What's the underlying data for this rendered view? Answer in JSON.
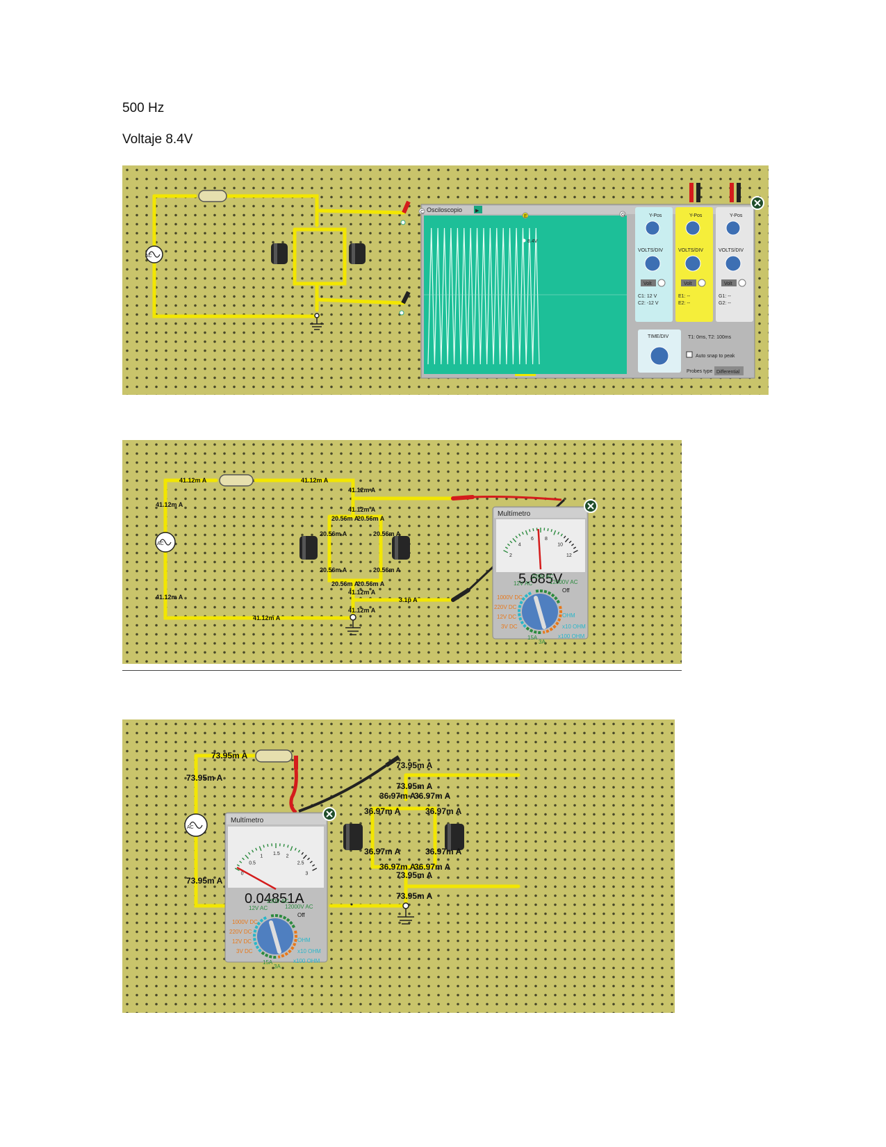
{
  "headings": {
    "frequency": "500 Hz",
    "voltage": "Voltaje 8.4V"
  },
  "colors": {
    "board": "#c9c46b",
    "wire": "#f2e600",
    "scope_screen": "#1dbf98",
    "trace": "#e8fff6",
    "probe_red": "#d41c1c",
    "probe_black": "#222222"
  },
  "panel1": {
    "source_label": "AC",
    "oscilloscope": {
      "title": "Osciloscopio",
      "marker_c": "C",
      "marker_e": "E",
      "marker_g": "G",
      "trace_label": "8.4V",
      "channels": [
        {
          "id": "C",
          "ypos": "Y-Pos",
          "volts": "VOLTS/DIV",
          "volt_btn": "Volt",
          "r1": "C1: 12 V",
          "r2": "C2: -12 V"
        },
        {
          "id": "E",
          "ypos": "Y-Pos",
          "volts": "VOLTS/DIV",
          "volt_btn": "Volt",
          "r1": "E1: --",
          "r2": "E2: --"
        },
        {
          "id": "G",
          "ypos": "Y-Pos",
          "volts": "VOLTS/DIV",
          "volt_btn": "Volt",
          "r1": "G1: --",
          "r2": "G2: --"
        }
      ],
      "time_div": "TIME/DIV",
      "t_readout": "T1: 0ms, T2: 100ms",
      "auto_snap": "Auto snap to peak",
      "probes_type_label": "Probes type",
      "probes_type_value": "Differential",
      "close_icon": "close-icon"
    }
  },
  "panel2": {
    "source_label": "AC",
    "currents": {
      "top_left": "41.12m A",
      "top_right": "41.12m A",
      "left_upper": "41.12m A",
      "left_lower": "41.12m A",
      "node_top_a": "41.12m A",
      "node_top_b": "41.12m A",
      "split_tl": "20.56m A",
      "split_tr": "20.56m A",
      "side_l_upper": "20.56m A",
      "side_r_upper": "20.56m A",
      "side_l_lower": "20.56m A",
      "side_r_lower": "20.56m A",
      "split_bl": "20.56m A",
      "split_br": "20.56m A",
      "node_bot_a": "41.12m A",
      "node_bot_b": "41.12m A",
      "probe_wire": "3.1p A",
      "bottom": "41.12m A"
    },
    "multimeter": {
      "title": "Multímetro",
      "reading": "5.685V",
      "needle_value": 5.685,
      "scale_max": 12,
      "scale_labels": [
        "2",
        "4",
        "6",
        "8",
        "10",
        "12"
      ],
      "ranges": [
        "12V AC",
        "220V AC",
        "12000V AC",
        "Off",
        "1000V DC",
        "220V DC",
        "12V DC",
        "3V DC",
        "15A",
        "3A",
        "OHM",
        "x10 OHM",
        "x100 OHM"
      ]
    }
  },
  "panel3": {
    "source_label": "AC",
    "currents": {
      "top": "73.95m A",
      "left_upper": "73.95m A",
      "left_lower": "73.95m A",
      "right_top1": "73.95m A",
      "right_top2": "73.95m A",
      "split_a": "36.97m A",
      "split_b": "36.97m A",
      "side_l_upper": "36.97m A",
      "side_r_upper": "36.97m A",
      "side_l_lower": "36.97m A",
      "side_r_lower": "36.97m A",
      "split_c": "36.97m A",
      "split_d": "36.97m A",
      "right_bot1": "73.95m A",
      "right_bot2": "73.95m A"
    },
    "multimeter": {
      "title": "Multímetro",
      "reading": "0.04851A",
      "needle_value": 0.04851,
      "scale_max": 3,
      "scale_labels": [
        "0",
        "0.5",
        "1",
        "1.5",
        "2",
        "2.5",
        "3"
      ],
      "ranges": [
        "12V AC",
        "220V AC",
        "12000V AC",
        "Off",
        "1000V DC",
        "220V DC",
        "12V DC",
        "3V DC",
        "15A",
        "3A",
        "OHM",
        "x10 OHM",
        "x100 OHM"
      ]
    }
  }
}
